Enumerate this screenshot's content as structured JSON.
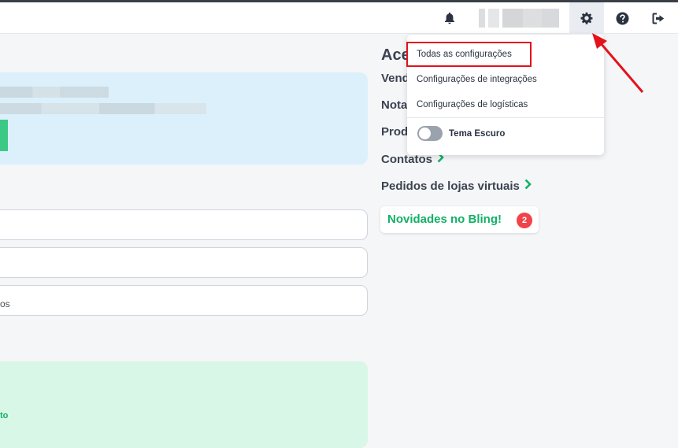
{
  "topbar": {
    "icons": [
      "bell-icon",
      "gear-icon",
      "help-icon",
      "logout-icon"
    ]
  },
  "settings_menu": {
    "items": [
      {
        "label": "Todas as configurações"
      },
      {
        "label": "Configurações de integrações"
      },
      {
        "label": "Configurações de logísticas"
      }
    ],
    "dark_theme": {
      "label": "Tema Escuro",
      "enabled": false
    }
  },
  "main": {
    "field3_text": "os",
    "promo_text": "to"
  },
  "shortcuts": {
    "title": "Ace",
    "items": [
      {
        "label": "Vend"
      },
      {
        "label": "Nota"
      },
      {
        "label": "Prod"
      },
      {
        "label": "Contatos"
      },
      {
        "label": "Pedidos de lojas virtuais"
      }
    ]
  },
  "news": {
    "label": "Novidades no Bling!",
    "count": "2"
  },
  "colors": {
    "accent_green": "#13b067",
    "highlight_red": "#e3121b",
    "badge_red": "#f0444a"
  }
}
